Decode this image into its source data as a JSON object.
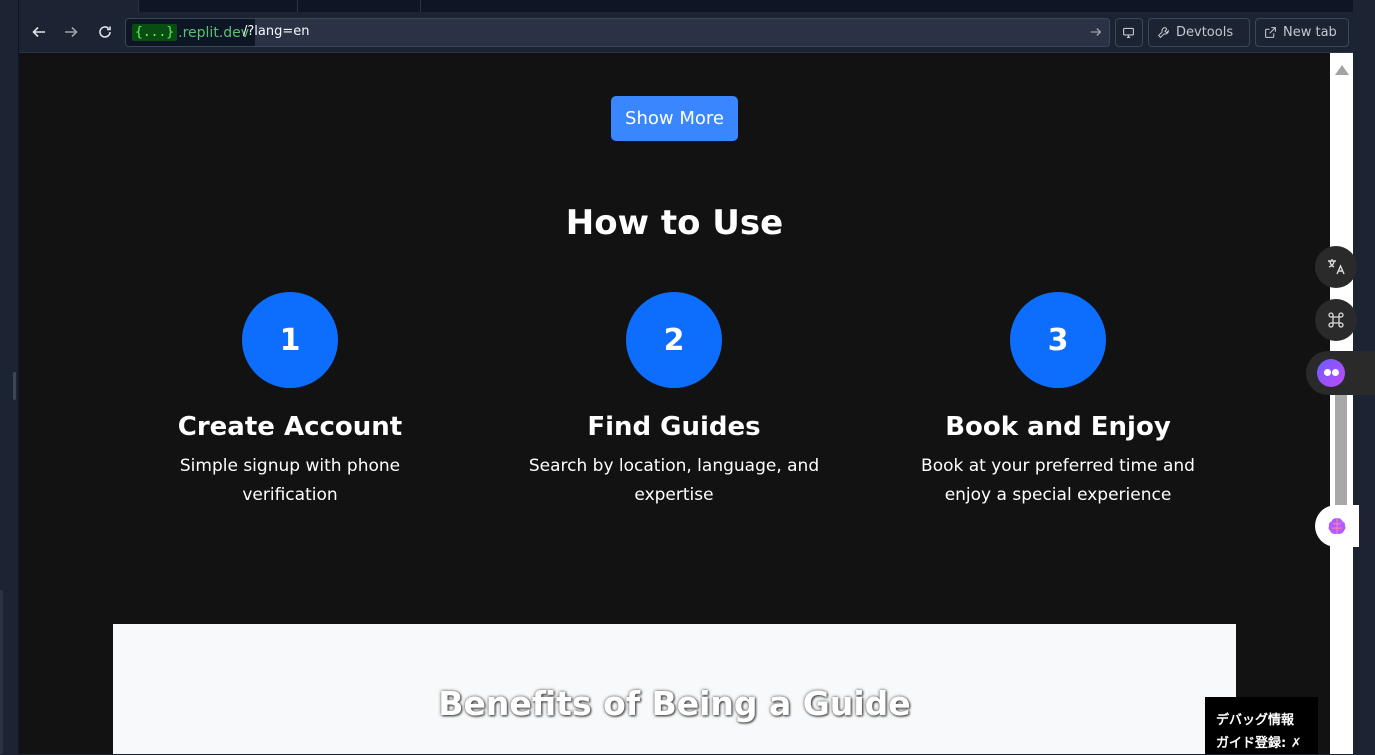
{
  "browser": {
    "domain_brace": "{...}",
    "domain": ".replit.dev",
    "path": "/?lang=en",
    "devtools_label": "Devtools",
    "newtab_label": "New tab"
  },
  "page": {
    "show_more_label": "Show More",
    "how_title": "How to Use",
    "steps": [
      {
        "number": "1",
        "title": "Create Account",
        "desc": "Simple signup with phone verification"
      },
      {
        "number": "2",
        "title": "Find Guides",
        "desc": "Search by location, language, and expertise"
      },
      {
        "number": "3",
        "title": "Book and Enjoy",
        "desc": "Book at your preferred time and enjoy a special experience"
      }
    ],
    "benefits_title": "Benefits of Being a Guide"
  },
  "debug": {
    "line1": "デバッグ情報",
    "line2": "ガイド登録: ✗"
  },
  "colors": {
    "accent": "#0d6efd",
    "show_more": "#3a86ff",
    "page_bg": "#121212"
  }
}
